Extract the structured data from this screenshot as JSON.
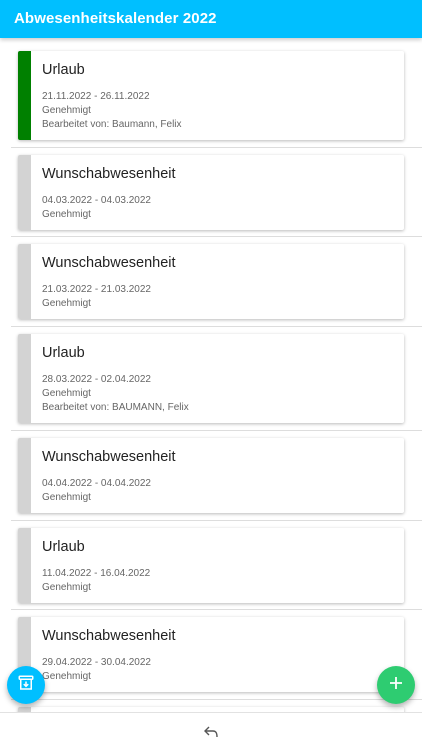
{
  "appbar": {
    "title": "Abwesenheitskalender 2022",
    "color": "#00bfff"
  },
  "entries": [
    {
      "type": "Urlaub",
      "dates": "21.11.2022 - 26.11.2022",
      "status": "Genehmigt",
      "editor": "Bearbeitet von: Baumann, Felix",
      "accent": "#008000"
    },
    {
      "type": "Wunschabwesenheit",
      "dates": "04.03.2022 - 04.03.2022",
      "status": "Genehmigt",
      "accent": "#d3d3d3"
    },
    {
      "type": "Wunschabwesenheit",
      "dates": "21.03.2022 - 21.03.2022",
      "status": "Genehmigt",
      "accent": "#d3d3d3"
    },
    {
      "type": "Urlaub",
      "dates": "28.03.2022 - 02.04.2022",
      "status": "Genehmigt",
      "editor": "Bearbeitet von: BAUMANN, Felix",
      "accent": "#d3d3d3"
    },
    {
      "type": "Wunschabwesenheit",
      "dates": "04.04.2022 - 04.04.2022",
      "status": "Genehmigt",
      "accent": "#d3d3d3"
    },
    {
      "type": "Urlaub",
      "dates": "11.04.2022 - 16.04.2022",
      "status": "Genehmigt",
      "accent": "#d3d3d3"
    },
    {
      "type": "Wunschabwesenheit",
      "dates": "29.04.2022 - 30.04.2022",
      "status": "Genehmigt",
      "accent": "#d3d3d3"
    }
  ],
  "fabs": {
    "left_icon": "archive-download-icon",
    "right_icon": "plus-icon",
    "right_color": "#2ecc71"
  },
  "bottombar": {
    "icon": "back-arrow-icon"
  }
}
